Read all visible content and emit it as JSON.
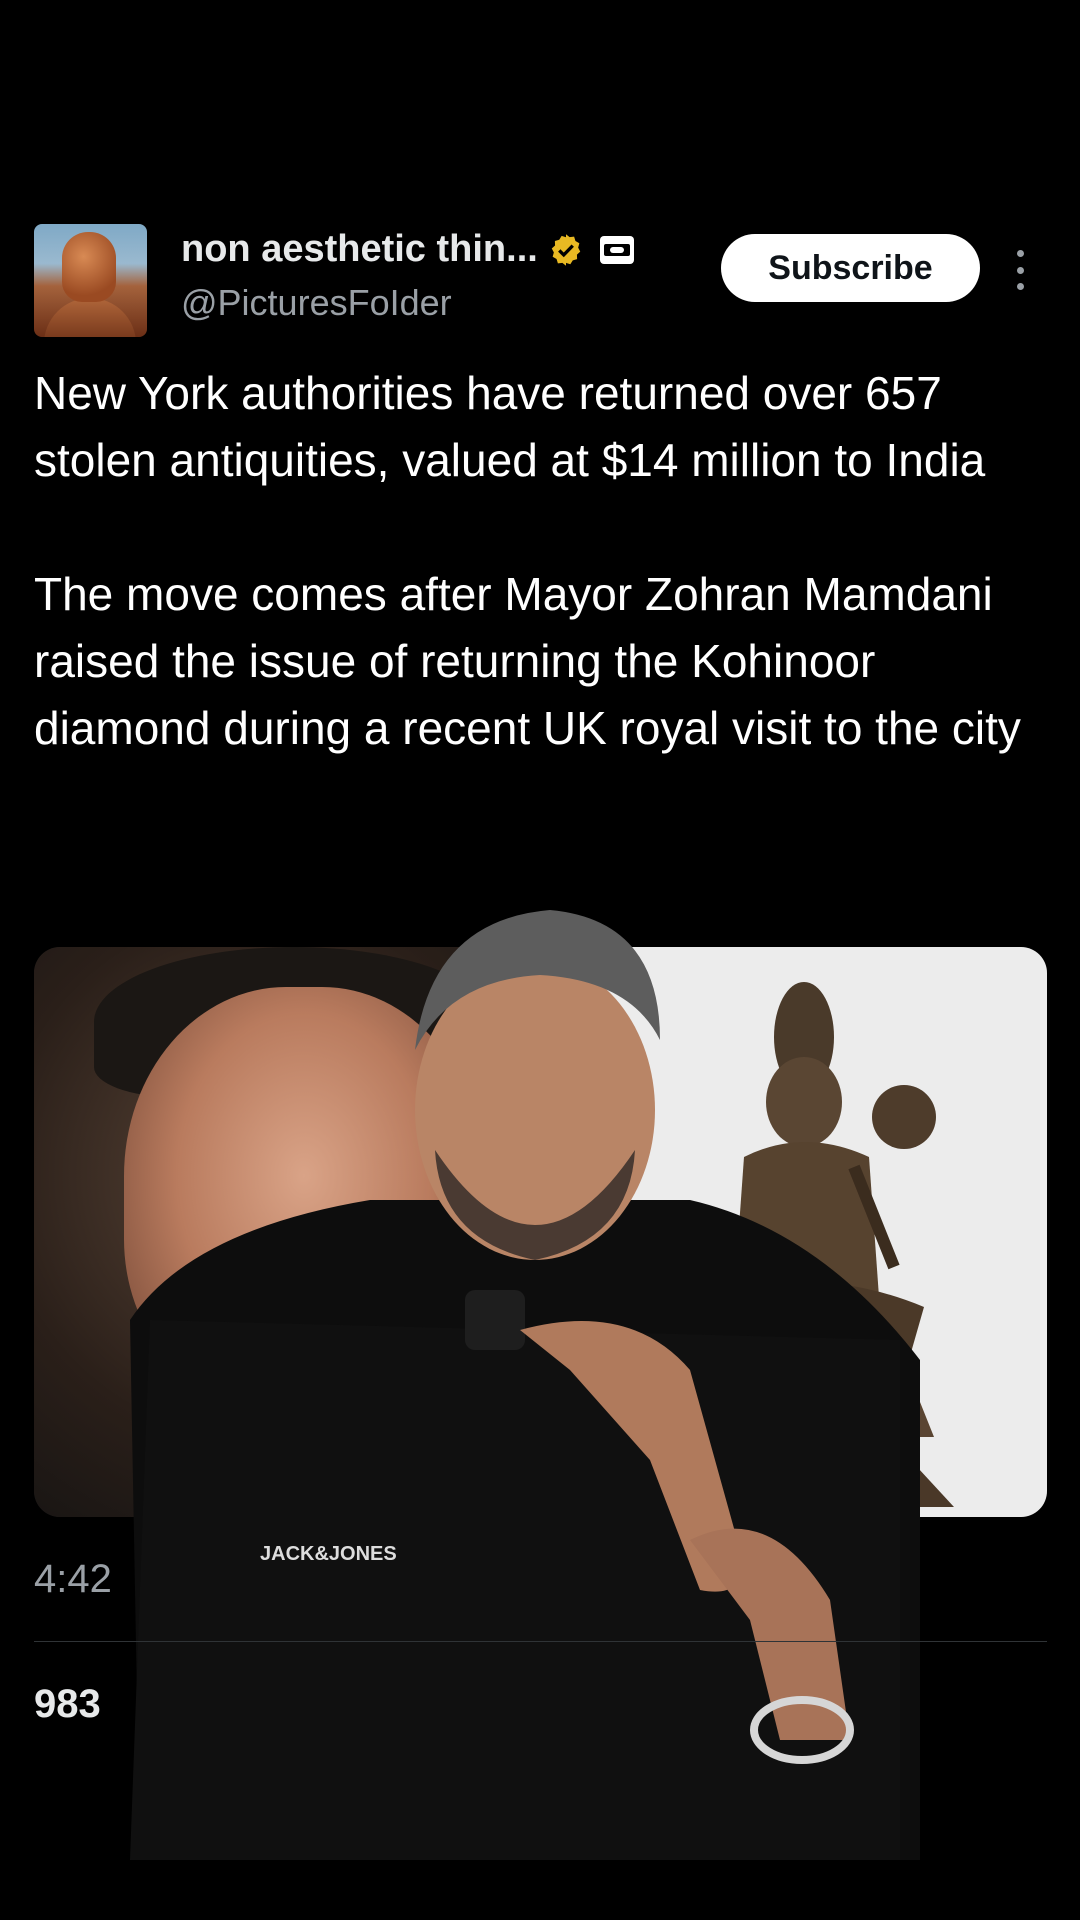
{
  "post": {
    "author": {
      "display_name": "non aesthetic thin...",
      "handle": "@PicturesFoIder",
      "verified_icon": "verified-badge-gold",
      "affiliation_icon": "affiliate-badge"
    },
    "subscribe_label": "Subscribe",
    "more_icon": "more-vertical-icon",
    "paragraphs": [
      "New York authorities have returned over 657 stolen antiquities, valued at $14 million to India",
      "The move comes after Mayor Zohran Mamdani raised the issue of returning the Kohinoor diamond during a recent UK royal visit to the city"
    ],
    "time": "4:42",
    "count": "983",
    "colors": {
      "background": "#000000",
      "text": "#ffffff",
      "secondary": "#9aa0a6",
      "verified": "#e8b923"
    }
  }
}
